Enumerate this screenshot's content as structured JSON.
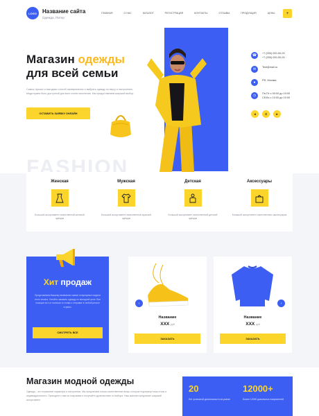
{
  "header": {
    "logo_label": "LOGO",
    "site_name": "Название сайта",
    "site_sub": "Одежда, Питер",
    "nav": [
      "Главная",
      "О нас",
      "Каталог",
      "Регистрация",
      "Контакты",
      "Отзывы",
      "Продукция",
      "Цены"
    ],
    "menu_icon": "+"
  },
  "hero": {
    "title_line1_a": "Магазин ",
    "title_line1_b": "одежды",
    "title_line2": "для всей семьи",
    "description": "Самых лучших и выгодных способ своевременно и выбрать одежду по вкусу и настроению. Мода нужна быть доступной для всех слоев населения. Мы предоставляем широкий выбор.",
    "cta_label": "Оставить заявку онлайн",
    "background_word": "FASHION"
  },
  "contacts": {
    "phones": [
      "+7 (000) 000-00-00",
      "+7 (000) 000-00-00"
    ],
    "email": "Test@mail.ru",
    "address": "РФ, Москва",
    "hours": [
      "Пн-Пт с 09:00 до 19:00",
      "Сб-Вс с 10:00 до 19:00"
    ],
    "slider_prev": "◂",
    "slider_mid": "3",
    "slider_next": "▸"
  },
  "categories": [
    {
      "title": "Женская",
      "desc": "Большой ассортимент качественной женской одежды",
      "icon": "dress-icon"
    },
    {
      "title": "Мужская",
      "desc": "Большой ассортимент качественной мужской одежды",
      "icon": "shirt-icon"
    },
    {
      "title": "Детская",
      "desc": "Большой ассортимент качественной детской одежды",
      "icon": "kids-icon"
    },
    {
      "title": "Аксессуары",
      "desc": "Большой ассортимент качественных аксессуаров",
      "icon": "bag-icon"
    }
  ],
  "hit": {
    "title_a": "Хит ",
    "title_b": "продаж",
    "desc": "Представляем Вашему вниманию самые популярные модели этого сезона. Успейте заказать одежду по выгодной цене. Все позиции есть в наличии и готовы к отправке в любой регион страны.",
    "button": "Смотреть все"
  },
  "products": [
    {
      "name": "Название",
      "price": "ХХХ",
      "unit": "руб",
      "button": "Заказать"
    },
    {
      "name": "Название",
      "price": "ХХХ",
      "unit": "руб",
      "button": "Заказать"
    }
  ],
  "arrows": {
    "prev": "‹",
    "next": "›"
  },
  "bottom": {
    "title": "Магазин модной одежды",
    "desc": "Одежда – это отражение характера и настроения. Мы предлагаем только качественные вещи, которые подчеркнут ваш стиль и индивидуальность. Приходите к нам за покупками и получайте удовольствие от выбора. Наш магазин предлагает широкий ассортимент.",
    "stats": [
      {
        "num": "20",
        "label": "Лет успешной деятельности на рынке"
      },
      {
        "num": "12000+",
        "label": "Более 12000 довольных покупателей"
      }
    ]
  },
  "colors": {
    "accent_blue": "#3c5ef2",
    "accent_yellow": "#fbd52b",
    "accent_orange": "#fbb91c"
  }
}
